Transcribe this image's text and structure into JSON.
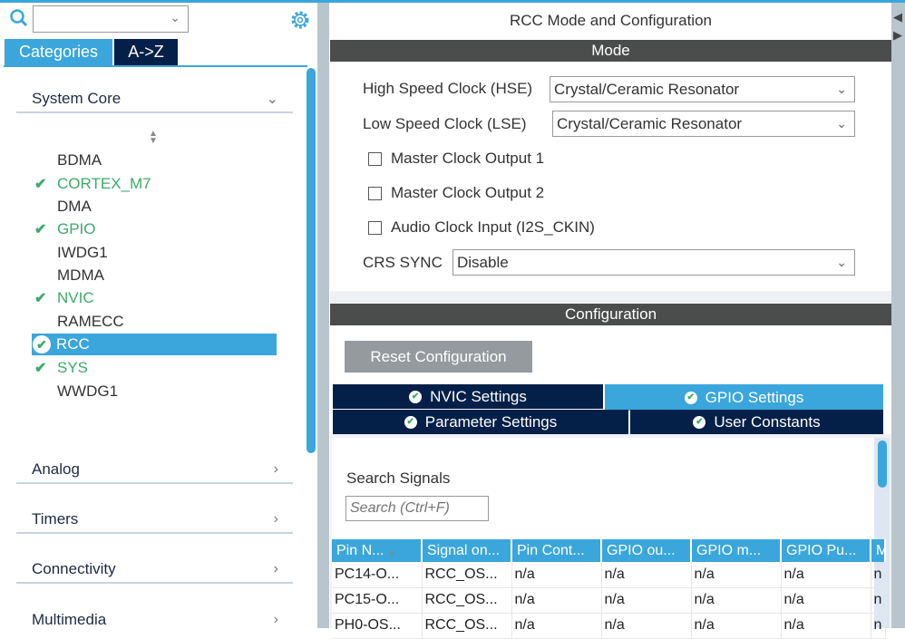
{
  "left": {
    "search_value": "",
    "tabs": [
      {
        "label": "Categories",
        "active": true
      },
      {
        "label": "A->Z",
        "active": false
      }
    ],
    "categories": [
      {
        "label": "System Core",
        "expanded": true
      },
      {
        "label": "Analog"
      },
      {
        "label": "Timers"
      },
      {
        "label": "Connectivity"
      },
      {
        "label": "Multimedia"
      }
    ],
    "system_core_items": [
      {
        "label": "BDMA",
        "configured": false
      },
      {
        "label": "CORTEX_M7",
        "configured": true
      },
      {
        "label": "DMA",
        "configured": false
      },
      {
        "label": "GPIO",
        "configured": true
      },
      {
        "label": "IWDG1",
        "configured": false
      },
      {
        "label": "MDMA",
        "configured": false
      },
      {
        "label": "NVIC",
        "configured": true
      },
      {
        "label": "RAMECC",
        "configured": false
      },
      {
        "label": "RCC",
        "configured": true,
        "selected": true
      },
      {
        "label": "SYS",
        "configured": true
      },
      {
        "label": "WWDG1",
        "configured": false
      }
    ]
  },
  "right": {
    "title": "RCC Mode and Configuration",
    "mode_header": "Mode",
    "hse_label": "High Speed Clock (HSE)",
    "hse_value": "Crystal/Ceramic Resonator",
    "lse_label": "Low Speed Clock (LSE)",
    "lse_value": "Crystal/Ceramic Resonator",
    "checkboxes": [
      {
        "label": "Master Clock Output 1",
        "checked": false
      },
      {
        "label": "Master Clock Output 2",
        "checked": false
      },
      {
        "label": "Audio Clock Input (I2S_CKIN)",
        "checked": false
      }
    ],
    "crs_label": "CRS SYNC",
    "crs_value": "Disable",
    "config_header": "Configuration",
    "reset_label": "Reset Configuration",
    "config_tabs": [
      "NVIC Settings",
      "GPIO Settings",
      "Parameter Settings",
      "User Constants"
    ],
    "active_tab": "GPIO Settings",
    "search_signals_label": "Search Signals",
    "search_placeholder": "Search (Ctrl+F)",
    "table": {
      "headers": [
        "Pin N...",
        "Signal on...",
        "Pin Cont...",
        "GPIO ou...",
        "GPIO m...",
        "GPIO Pu...",
        "M"
      ],
      "rows": [
        [
          "PC14-O...",
          "RCC_OS...",
          "n/a",
          "n/a",
          "n/a",
          "n/a",
          "n"
        ],
        [
          "PC15-O...",
          "RCC_OS...",
          "n/a",
          "n/a",
          "n/a",
          "n/a",
          "n"
        ],
        [
          "PH0-OS...",
          "RCC_OS...",
          "n/a",
          "n/a",
          "n/a",
          "n/a",
          "n"
        ]
      ]
    }
  }
}
